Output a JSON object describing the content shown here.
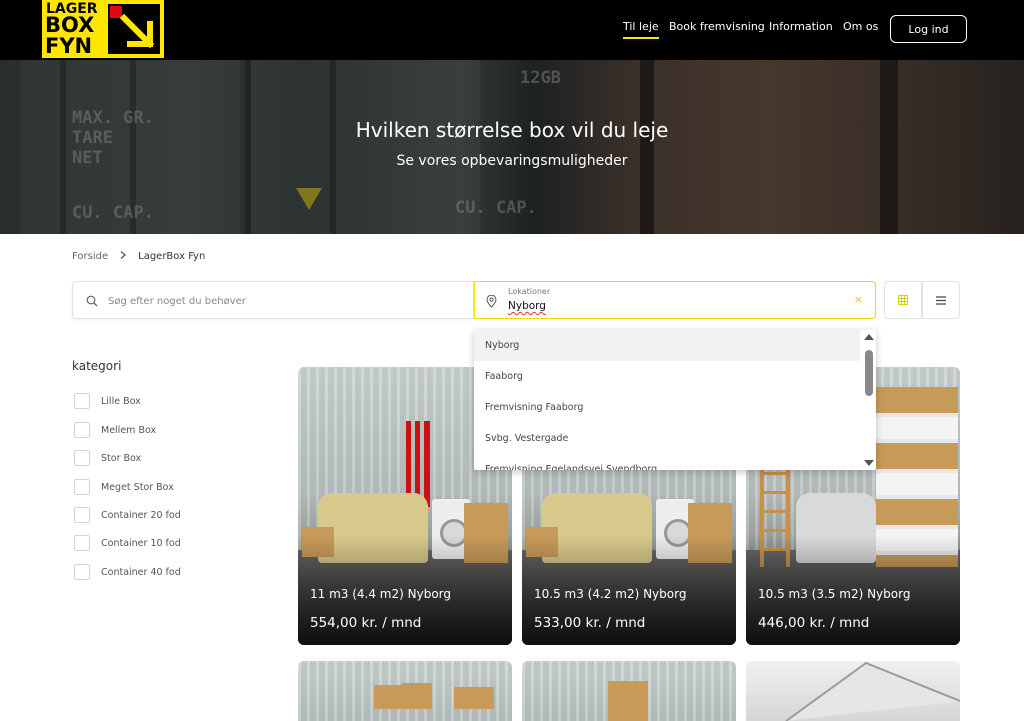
{
  "brand": {
    "line1": "LAGER",
    "line2": "BOX",
    "line3": "FYN"
  },
  "nav": {
    "items": [
      {
        "label": "Til leje",
        "active": true
      },
      {
        "label": "Book fremvisning",
        "active": false
      },
      {
        "label": "Information",
        "active": false
      },
      {
        "label": "Om os",
        "active": false
      }
    ],
    "login": "Log ind"
  },
  "hero": {
    "title": "Hvilken størrelse box vil du leje",
    "subtitle": "Se vores opbevaringsmuligheder",
    "stencil_left": "MAX. GR.\nTARE\nNET",
    "stencil_code": "12GB",
    "stencil_cap": "CU. CAP."
  },
  "breadcrumb": {
    "home": "Forside",
    "current": "LagerBox Fyn"
  },
  "search": {
    "placeholder": "Søg efter noget du behøver",
    "value": ""
  },
  "location": {
    "label": "Lokationer",
    "value": "Nyborg",
    "clear": "×"
  },
  "categories": {
    "title": "kategori",
    "items": [
      "Lille Box",
      "Mellem Box",
      "Stor Box",
      "Meget Stor Box",
      "Container 20 fod",
      "Container 10 fod",
      "Container 40 fod"
    ]
  },
  "dropdown": {
    "options": [
      "Nyborg",
      "Faaborg",
      "Fremvisning Faaborg",
      "Svbg. Vestergade",
      "Fremvisning Egelandsvej Svendborg"
    ],
    "highlighted": 0
  },
  "cards": [
    {
      "title": "11 m3 (4.4 m2) Nyborg",
      "price": "554,00 kr. / mnd"
    },
    {
      "title": "10.5 m3 (4.2 m2) Nyborg",
      "price": "533,00 kr. / mnd"
    },
    {
      "title": "10.5 m3 (3.5 m2) Nyborg",
      "price": "446,00 kr. / mnd"
    }
  ],
  "colors": {
    "accent": "#ffe600",
    "header_bg": "#000000",
    "logo_red": "#e30613"
  }
}
